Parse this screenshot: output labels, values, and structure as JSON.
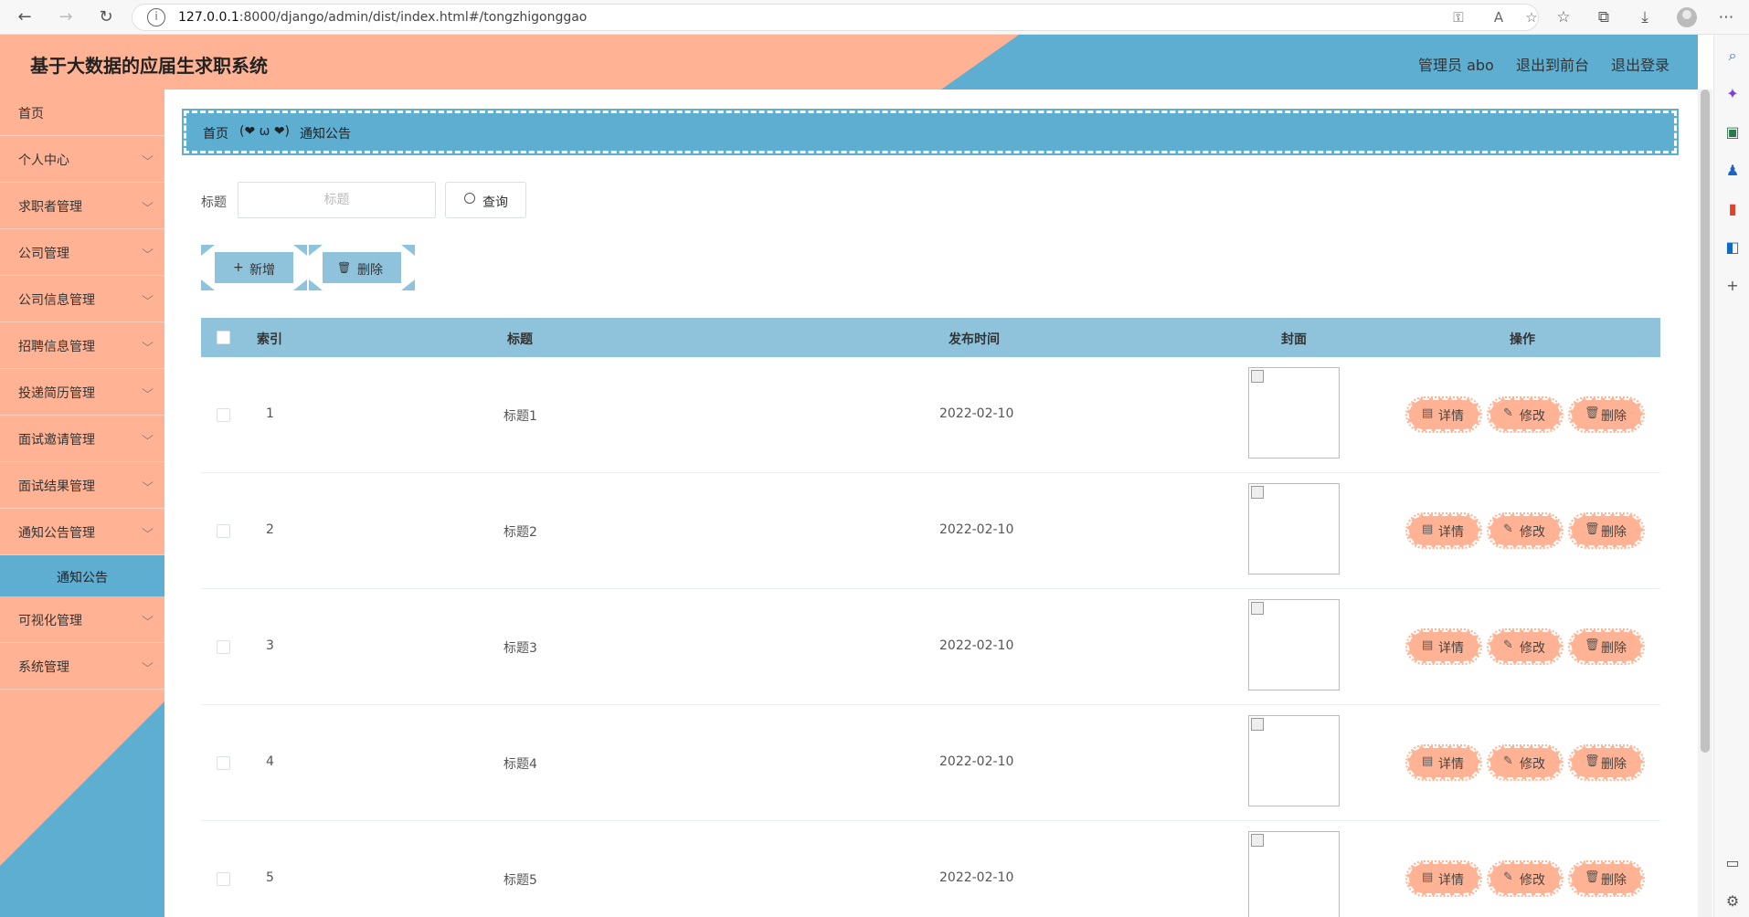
{
  "browser": {
    "url_host": "127.0.0.1",
    "url_rest": ":8000/django/admin/dist/index.html#/tongzhigonggao"
  },
  "header": {
    "title": "基于大数据的应届生求职系统",
    "user": "管理员 abo",
    "back_to_front": "退出到前台",
    "logout": "退出登录"
  },
  "sidebar": {
    "items": [
      {
        "label": "首页",
        "has_children": false
      },
      {
        "label": "个人中心",
        "has_children": true
      },
      {
        "label": "求职者管理",
        "has_children": true
      },
      {
        "label": "公司管理",
        "has_children": true
      },
      {
        "label": "公司信息管理",
        "has_children": true
      },
      {
        "label": "招聘信息管理",
        "has_children": true
      },
      {
        "label": "投递简历管理",
        "has_children": true
      },
      {
        "label": "面试邀请管理",
        "has_children": true
      },
      {
        "label": "面试结果管理",
        "has_children": true
      },
      {
        "label": "通知公告管理",
        "has_children": true
      },
      {
        "label": "可视化管理",
        "has_children": true
      },
      {
        "label": "系统管理",
        "has_children": true
      }
    ],
    "active_sub": "通知公告",
    "chevron": "⌵"
  },
  "breadcrumb": {
    "home": "首页",
    "separator": "(❤ ω ❤)",
    "current": "通知公告"
  },
  "search": {
    "label": "标题",
    "placeholder": "标题",
    "button": "查询"
  },
  "actions": {
    "add": "新增",
    "delete": "删除",
    "add_icon": "+",
    "delete_icon": "🗑"
  },
  "table": {
    "columns": [
      "索引",
      "标题",
      "发布时间",
      "封面",
      "操作"
    ],
    "rows": [
      {
        "index": "1",
        "title": "标题1",
        "date": "2022-02-10"
      },
      {
        "index": "2",
        "title": "标题2",
        "date": "2022-02-10"
      },
      {
        "index": "3",
        "title": "标题3",
        "date": "2022-02-10"
      },
      {
        "index": "4",
        "title": "标题4",
        "date": "2022-02-10"
      },
      {
        "index": "5",
        "title": "标题5",
        "date": "2022-02-10"
      }
    ],
    "ops": {
      "detail": "详情",
      "edit": "修改",
      "delete": "删除"
    },
    "op_icons": {
      "detail": "▤",
      "edit": "✎",
      "delete": "🗑"
    }
  },
  "colors": {
    "peach": "#ffb394",
    "blue": "#5daed1",
    "light_blue": "#8fc3dc"
  }
}
